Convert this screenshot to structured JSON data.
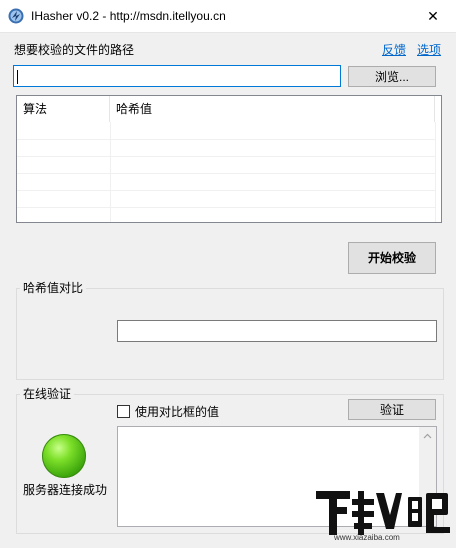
{
  "window": {
    "title": "IHasher v0.2 - http://msdn.itellyou.cn",
    "close_glyph": "✕"
  },
  "path": {
    "label": "想要校验的文件的路径",
    "feedback_link": "反馈",
    "options_link": "选项",
    "value": "",
    "browse_button": "浏览..."
  },
  "hash_list": {
    "columns": [
      "算法",
      "哈希值"
    ],
    "rows": []
  },
  "start_button": "开始校验",
  "compare": {
    "group_title": "哈希值对比",
    "value": ""
  },
  "online": {
    "group_title": "在线验证",
    "checkbox_label": "使用对比框的值",
    "checkbox_checked": false,
    "verify_button": "验证",
    "result_text": "",
    "status_text": "服务器连接成功",
    "status_color": "#4cbb17"
  },
  "watermark": {
    "brand": "下载吧",
    "url": "www.xiazaiba.com"
  }
}
